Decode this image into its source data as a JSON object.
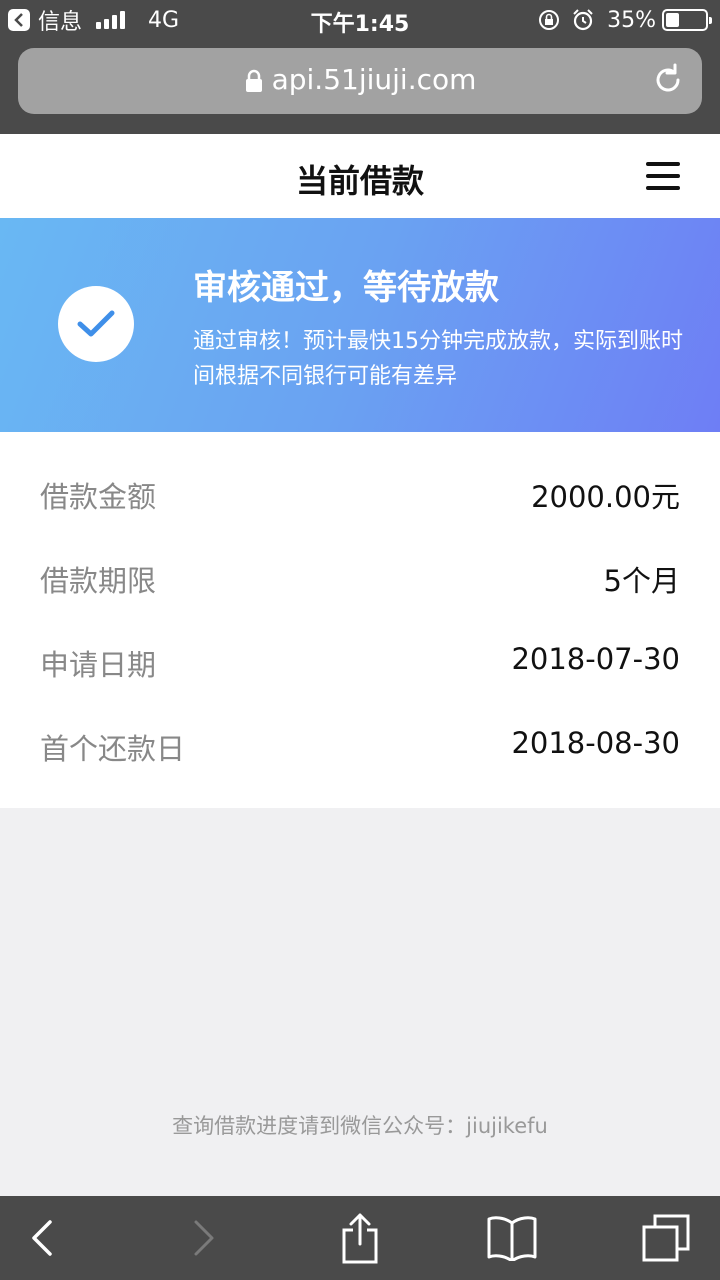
{
  "status_bar": {
    "back_app": "信息",
    "network": "4G",
    "time": "下午1:45",
    "battery": "35%"
  },
  "browser": {
    "url": "api.51jiuji.com"
  },
  "header": {
    "title": "当前借款"
  },
  "banner": {
    "title": "审核通过，等待放款",
    "description": "通过审核！预计最快15分钟完成放款，实际到账时间根据不同银行可能有差异"
  },
  "details": [
    {
      "label": "借款金额",
      "value": "2000.00元"
    },
    {
      "label": "借款期限",
      "value": "5个月"
    },
    {
      "label": "申请日期",
      "value": "2018-07-30"
    },
    {
      "label": "首个还款日",
      "value": "2018-08-30"
    }
  ],
  "footer": {
    "note": "查询借款进度请到微信公众号：jiujikefu"
  },
  "colors": {
    "banner_start": "#69b8f3",
    "banner_end": "#6e7ef5",
    "check": "#3f8fe9"
  }
}
